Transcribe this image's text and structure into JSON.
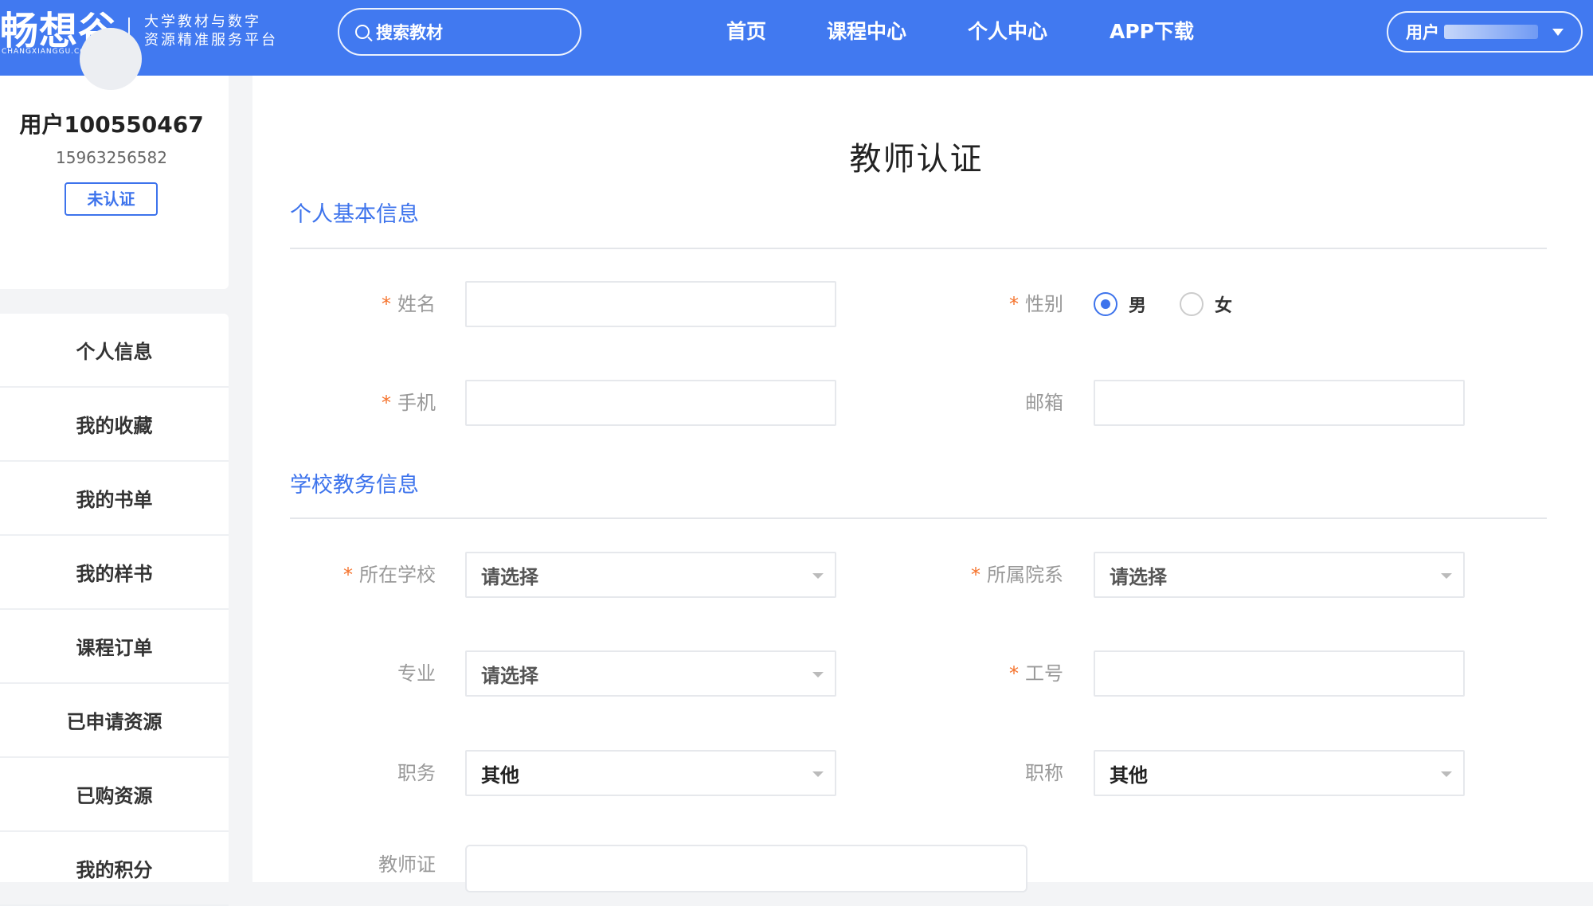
{
  "colors": {
    "brand": "#4179f0",
    "accent": "#3d73ec",
    "required": "#f5722b"
  },
  "header": {
    "logo_text": "畅想谷",
    "logo_en": "CHANGXIANGGU.COM",
    "slogan_line1": "大学教材与数字",
    "slogan_line2": "资源精准服务平台",
    "search_placeholder": "搜索教材",
    "nav": [
      "首页",
      "课程中心",
      "个人中心",
      "APP下载"
    ],
    "user_label": "用户"
  },
  "profile": {
    "name": "用户100550467",
    "phone": "15963256582",
    "status": "未认证"
  },
  "menu": [
    "个人信息",
    "我的收藏",
    "我的书单",
    "我的样书",
    "课程订单",
    "已申请资源",
    "已购资源",
    "我的积分"
  ],
  "form": {
    "title": "教师认证",
    "section_basic": "个人基本信息",
    "section_school": "学校教务信息",
    "name_label": "姓名",
    "gender_label": "性别",
    "gender_options": [
      "男",
      "女"
    ],
    "gender_selected": "男",
    "phone_label": "手机",
    "email_label": "邮箱",
    "school_label": "所在学校",
    "school_value": "请选择",
    "dept_label": "所属院系",
    "dept_value": "请选择",
    "major_label": "专业",
    "major_value": "请选择",
    "staff_id_label": "工号",
    "position_label": "职务",
    "position_value": "其他",
    "title_label": "职称",
    "title_value": "其他",
    "cert_label": "教师证",
    "required_mark": "*"
  }
}
